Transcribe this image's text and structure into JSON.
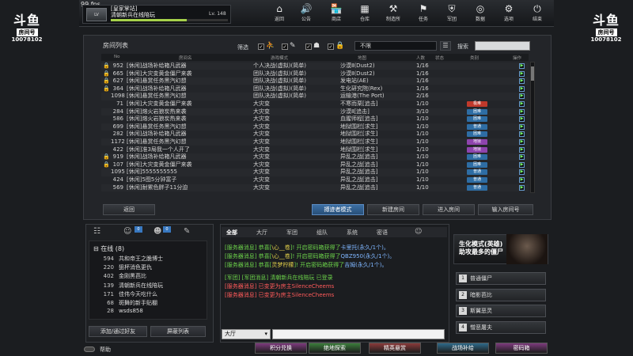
{
  "topbar": {
    "fps": "99 fps",
    "server_name": "[皇家掌站]",
    "room_title": "清朝新兵在线陪玩",
    "level": "Lv. 148",
    "exp_progress": 0.65,
    "nav": [
      {
        "icon": "home-icon",
        "glyph": "⌂",
        "label": "返回"
      },
      {
        "icon": "megaphone-icon",
        "glyph": "🔊",
        "label": "公告"
      },
      {
        "icon": "shop-icon",
        "glyph": "🏪",
        "label": "商店"
      },
      {
        "icon": "warehouse-icon",
        "glyph": "▦",
        "label": "仓库"
      },
      {
        "icon": "workshop-icon",
        "glyph": "⚒",
        "label": "制造所"
      },
      {
        "icon": "mission-icon",
        "glyph": "⚑",
        "label": "任务"
      },
      {
        "icon": "clan-icon",
        "glyph": "⛨",
        "label": "军团"
      },
      {
        "icon": "stats-icon",
        "glyph": "◎",
        "label": "数据"
      },
      {
        "icon": "settings-icon",
        "glyph": "⚙",
        "label": "选项"
      },
      {
        "icon": "exit-icon",
        "glyph": "⏻",
        "label": "结束"
      }
    ]
  },
  "side_logo": {
    "mark": "斗鱼",
    "tag": "房间号",
    "number": "10078102"
  },
  "room_list": {
    "title": "房间列表",
    "filter_label": "筛选",
    "mode_select": "不限",
    "search_label": "搜索",
    "search_value": "",
    "columns": [
      "No",
      "房间名",
      "游戏模式",
      "地图",
      "人数",
      "状态",
      "类别",
      "操作"
    ],
    "rows": [
      {
        "lock": true,
        "no": "952",
        "name": "[休闲]战场补给箱凡武器",
        "mode": "个人决战(虚拟)(简单)",
        "map": "沙漠Ⅱ(Dust2)",
        "count": "1/16",
        "tag": "",
        "tag_color": ""
      },
      {
        "lock": true,
        "no": "665",
        "name": "[休闲]大灾变黄金僵尸来袭",
        "mode": "团队决战(虚拟)(简单)",
        "map": "沙漠Ⅱ(Dust2)",
        "count": "1/16",
        "tag": "",
        "tag_color": ""
      },
      {
        "lock": true,
        "no": "627",
        "name": "[休闲]悬赏任务黑汽幻想",
        "mode": "团队决战(虚拟)(简单)",
        "map": "发电站(AE)",
        "count": "1/16",
        "tag": "",
        "tag_color": ""
      },
      {
        "lock": true,
        "no": "364",
        "name": "[休闲]战场补给箱凡武器",
        "mode": "团队决战(虚拟)(简单)",
        "map": "生化研究院(Rex)",
        "count": "1/16",
        "tag": "",
        "tag_color": ""
      },
      {
        "lock": false,
        "no": "1098",
        "name": "[休闲]悬赏任务黑汽幻想",
        "mode": "团队决战(虚拟)(简单)",
        "map": "运输港(The Port)",
        "count": "2/16",
        "tag": "",
        "tag_color": ""
      },
      {
        "lock": false,
        "no": "71",
        "name": "[休闲]大灾变黄金僵尸来袭",
        "mode": "大灾变",
        "map": "不寒而栗[追击]",
        "count": "1/10",
        "tag": "极难",
        "tag_color": "#c0392b"
      },
      {
        "lock": false,
        "no": "284",
        "name": "[休闲]熔火岩狼炭热来袭",
        "mode": "大灾变",
        "map": "沙漠Ⅱ[追击]",
        "count": "3/10",
        "tag": "困难",
        "tag_color": "#2e6da4"
      },
      {
        "lock": false,
        "no": "586",
        "name": "[休闲]熔火岩狼炭热来袭",
        "mode": "大灾变",
        "map": "血腥师程[追击]",
        "count": "1/10",
        "tag": "困难",
        "tag_color": "#2e6da4"
      },
      {
        "lock": false,
        "no": "699",
        "name": "[休闲]悬赏任务黑汽幻想",
        "mode": "大灾变",
        "map": "地狱围栏[求生]",
        "count": "1/10",
        "tag": "普通",
        "tag_color": "#2e6da4"
      },
      {
        "lock": false,
        "no": "282",
        "name": "[休闲]战场补给箱凡武器",
        "mode": "大灾变",
        "map": "地狱围栏[求生]",
        "count": "1/10",
        "tag": "困难",
        "tag_color": "#2e6da4"
      },
      {
        "lock": false,
        "no": "1172",
        "name": "[休闲]悬赏任务黑汽幻想",
        "mode": "大灾变",
        "map": "地狱围栏[求生]",
        "count": "1/10",
        "tag": "地狱",
        "tag_color": "#8e44ad"
      },
      {
        "lock": false,
        "no": "422",
        "name": "[休闲]准3局我一个人开了",
        "mode": "大灾变",
        "map": "地狱围栏[求生]",
        "count": "1/10",
        "tag": "地狱",
        "tag_color": "#8e44ad"
      },
      {
        "lock": true,
        "no": "919",
        "name": "[休闲]战场补给箱凡武器",
        "mode": "大灾变",
        "map": "异乱之战[追击]",
        "count": "1/10",
        "tag": "困难",
        "tag_color": "#2e6da4"
      },
      {
        "lock": true,
        "no": "107",
        "name": "[休闲]大灾变黄金僵尸来袭",
        "mode": "大灾变",
        "map": "异乱之战[追击]",
        "count": "1/10",
        "tag": "困难",
        "tag_color": "#2e6da4"
      },
      {
        "lock": false,
        "no": "1095",
        "name": "[休闲]5555555555",
        "mode": "大灾变",
        "map": "异乱之战[追击]",
        "count": "1/10",
        "tag": "普通",
        "tag_color": "#2e6da4"
      },
      {
        "lock": false,
        "no": "424",
        "name": "[休闲]5图5分钟富子",
        "mode": "大灾变",
        "map": "异乱之战[追击]",
        "count": "1/10",
        "tag": "普通",
        "tag_color": "#2e6da4"
      },
      {
        "lock": false,
        "no": "569",
        "name": "[休闲]耐累色胖子11分迫",
        "mode": "大灾变",
        "map": "异乱之战[追击]",
        "count": "1/10",
        "tag": "普通",
        "tag_color": "#2e6da4"
      }
    ],
    "buttons": {
      "back": "返回",
      "spectator": "搏迹者模式",
      "create": "新建房间",
      "join": "进入房间",
      "enter_number": "输入房间号"
    }
  },
  "friends": {
    "badges": [
      "0",
      "0"
    ],
    "online_header": "在线 (8)",
    "list": [
      {
        "id": "594",
        "name": "共和帝王之脆博士"
      },
      {
        "id": "220",
        "name": "狙杯消色更仇"
      },
      {
        "id": "402",
        "name": "金刚黑芭比"
      },
      {
        "id": "139",
        "name": "清朝新兵在线陪玩"
      },
      {
        "id": "171",
        "name": "佳伟今天吃什么"
      },
      {
        "id": "68",
        "name": "斑舞的新手贴棚"
      },
      {
        "id": "28",
        "name": "wsds858"
      }
    ],
    "add_button": "添加/通过好友",
    "block_button": "屏蔽列表"
  },
  "chat": {
    "tabs": [
      "全部",
      "大厅",
      "军团",
      "组队",
      "系统",
      "密语"
    ],
    "lines": [
      {
        "parts": [
          {
            "t": "[服务器消息] 恭喜[",
            "c": "sys"
          },
          {
            "t": "\\心__卷",
            "c": "yel"
          },
          {
            "t": "]! 开启密码箱获得了",
            "c": "sys"
          },
          {
            "t": "卡里托(永久/1个)。",
            "c": "name"
          }
        ]
      },
      {
        "parts": [
          {
            "t": "[服务器消息] 恭喜[",
            "c": "sys"
          },
          {
            "t": "\\心__卷",
            "c": "yel"
          },
          {
            "t": "]! 开启密码箱获得了",
            "c": "sys"
          },
          {
            "t": "QBZ950(永久/1个)。",
            "c": "name"
          }
        ]
      },
      {
        "parts": [
          {
            "t": "[服务器消息] 恭喜[",
            "c": "sys"
          },
          {
            "t": "灵梦柠檬",
            "c": "yel"
          },
          {
            "t": "]! 开启密码箱获得了",
            "c": "sys"
          },
          {
            "t": "吉姆(永久/1个)。",
            "c": "name"
          }
        ]
      },
      {
        "parts": [
          {
            "t": "[军团] [军团消息] 清朝新兵在线陪玩 已登录",
            "c": "sys"
          }
        ]
      },
      {
        "parts": [
          {
            "t": "[服务器消息] 已变更为房主SilenceCheems",
            "c": "red"
          }
        ]
      },
      {
        "parts": [
          {
            "t": "[服务器消息] 已变更为房主SilenceCheems",
            "c": "red"
          }
        ]
      }
    ],
    "channel": "大厅",
    "input_value": ""
  },
  "mode_panel": {
    "title": "生化模式(英雄)",
    "subtitle": "助攻最多的僵尸",
    "options": [
      {
        "n": "1",
        "label": "普通僵尸"
      },
      {
        "n": "2",
        "label": "暗影芭比"
      },
      {
        "n": "3",
        "label": "斯翼恶灵"
      },
      {
        "n": "4",
        "label": "憎恶屠夫"
      }
    ]
  },
  "bottombar": {
    "help": "帮助",
    "buttons": [
      {
        "label": "积分兑换",
        "color": "#7d3a7d"
      },
      {
        "label": "绝地探索",
        "color": "#3b7d3b"
      },
      {
        "label": "精英悬赏",
        "color": "#8a3a3a"
      },
      {
        "label": "战场补给",
        "color": "#2f6a8a"
      },
      {
        "label": "密码箱",
        "color": "#7d3a7d"
      }
    ]
  }
}
